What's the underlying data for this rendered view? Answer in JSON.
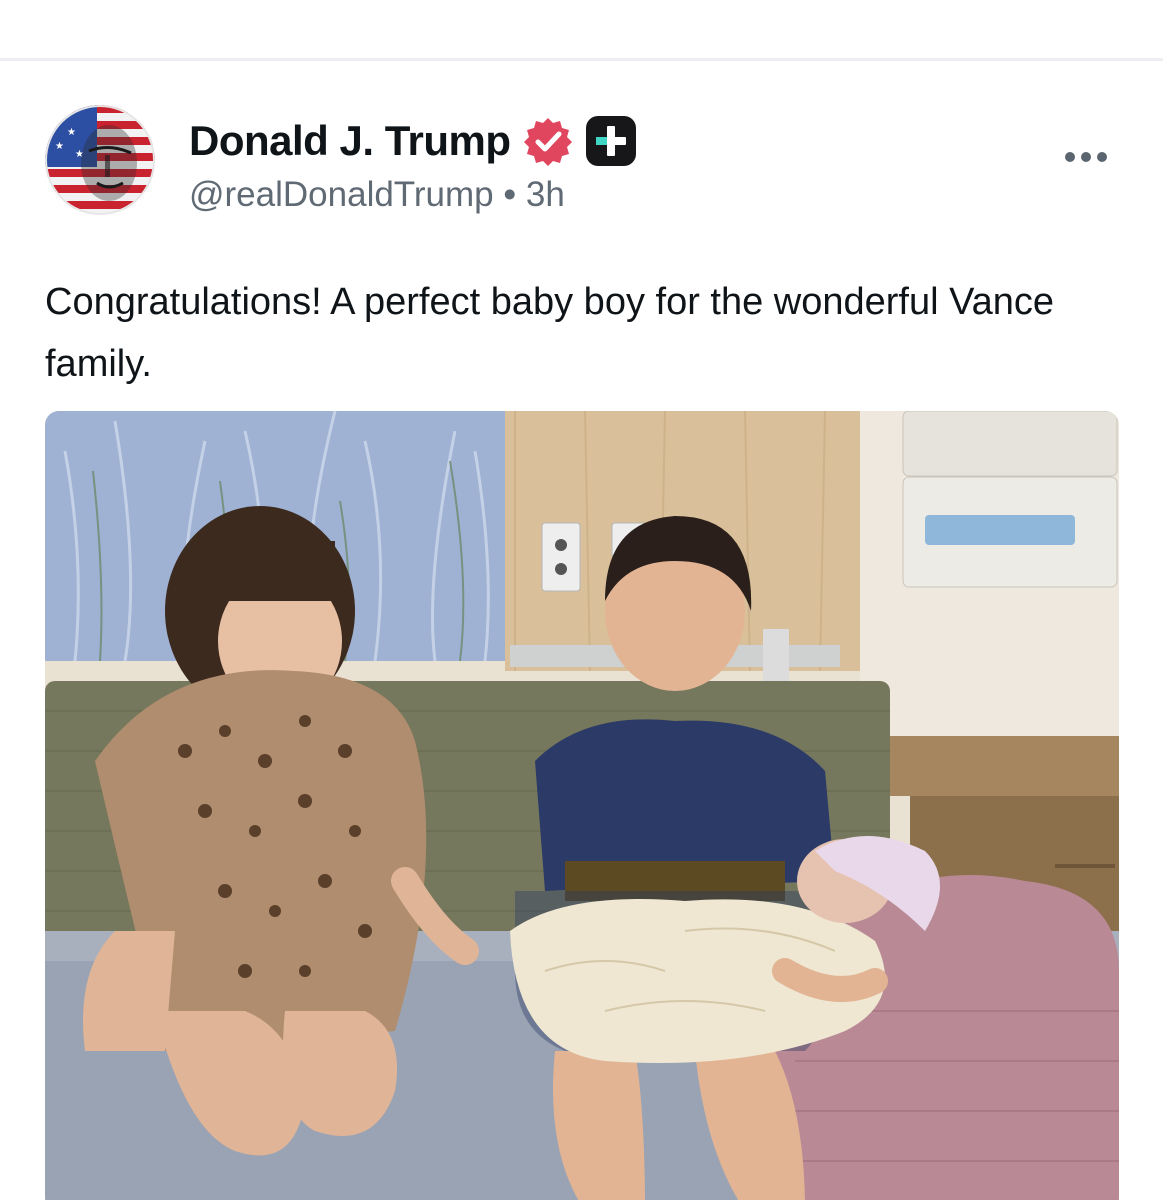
{
  "post": {
    "author": {
      "display_name": "Donald J. Trump",
      "handle": "@realDonaldTrump",
      "avatar_icon": "flag-portrait-avatar",
      "verified_icon": "verified-badge-icon",
      "verified_color": "#e0465e",
      "plus_icon": "platform-plus-icon"
    },
    "separator": "•",
    "timestamp": "3h",
    "more_icon": "more-options-icon",
    "text": "Congratulations! A perfect baby boy for the wonderful Vance family.",
    "media": {
      "type": "photo"
    }
  },
  "colors": {
    "text_primary": "#0f1419",
    "text_secondary": "#606a74",
    "divider": "#eceef1"
  }
}
